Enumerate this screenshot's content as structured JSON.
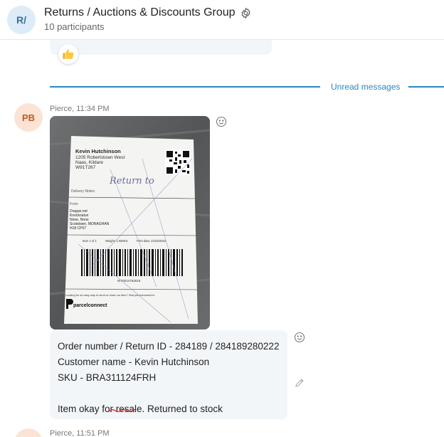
{
  "header": {
    "avatar_initials": "R/",
    "title": "Returns / Auctions & Discounts Group",
    "participants": "10 participants",
    "settings_icon": "gear-icon"
  },
  "previous_message": {
    "reaction": "thumbs-up"
  },
  "divider": {
    "label": "Unread messages"
  },
  "message": {
    "avatar_initials": "PB",
    "meta": "Pierce, 11:34 PM",
    "label": {
      "recipient_name": "Kevin Hutchinson",
      "recipient_address": [
        "1205 Robertstown West",
        "Naas, Kildare",
        "W91T267"
      ],
      "delivery_notes": "Delivery Notes:",
      "handwriting": "Return to",
      "from_label": "From",
      "from_lines": [
        "Dragan.net",
        "Knocknatun",
        "None, None",
        "Scotstown, MONAGHAN",
        "H18 CP57"
      ],
      "details": [
        "Item 1 of 1",
        "Weight: 1.000KG",
        "Print date: 21/03/2022"
      ],
      "tracking": "WY0014763016",
      "promo": "Looking for an easy way to send or return an item? Visit parcelconnect.ie",
      "brand": "parcelconnect"
    },
    "lines": [
      "Order number / Return ID - 284189 / 284189280222",
      "Customer name - Kevin Hutchinson",
      "SKU - BRA311124FRH",
      "",
      "Item okay for resale. Returned to stock"
    ]
  },
  "next_message": {
    "meta": "Pierce, 11:51 PM"
  },
  "colors": {
    "accent": "#2b88c4",
    "bubble": "#f3f6f9",
    "sender_avatar_bg": "#fbe3d5",
    "sender_avatar_fg": "#c4591c"
  }
}
